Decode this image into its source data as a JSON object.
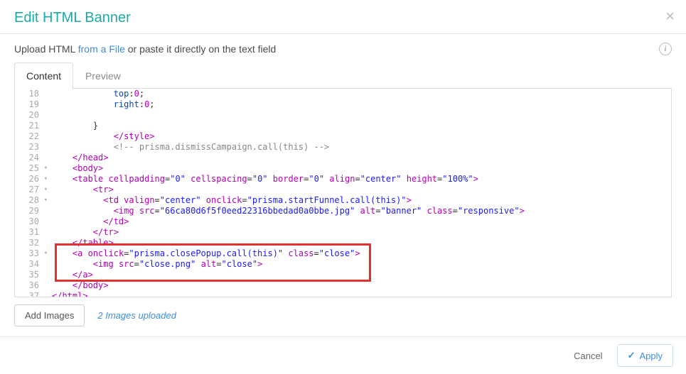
{
  "modal": {
    "title": "Edit HTML Banner",
    "close_glyph": "×"
  },
  "upload": {
    "prefix": "Upload HTML ",
    "link": "from a File",
    "suffix": " or paste it directly on the text field",
    "info_glyph": "i"
  },
  "tabs": {
    "content": "Content",
    "preview": "Preview"
  },
  "code": {
    "lines": [
      {
        "n": 18,
        "indent": "            ",
        "html": "<span class='t-id'>top</span><span class='t-text'>:</span><span class='t-num'>0</span><span class='t-text'>;</span>"
      },
      {
        "n": 19,
        "indent": "            ",
        "html": "<span class='t-id'>right</span><span class='t-text'>:</span><span class='t-num'>0</span><span class='t-text'>;</span>"
      },
      {
        "n": 20,
        "indent": "",
        "html": ""
      },
      {
        "n": 21,
        "indent": "        ",
        "html": "<span class='t-text'>}</span>"
      },
      {
        "n": 22,
        "indent": "            ",
        "html": "<span class='t-tag'>&lt;/style&gt;</span>"
      },
      {
        "n": 23,
        "indent": "            ",
        "html": "<span class='t-com'>&lt;!-- prisma.dismissCampaign.call(this) --&gt;</span>"
      },
      {
        "n": 24,
        "indent": "    ",
        "html": "<span class='t-tag'>&lt;/head&gt;</span>"
      },
      {
        "n": 25,
        "fold": true,
        "indent": "    ",
        "html": "<span class='t-tag'>&lt;body&gt;</span>"
      },
      {
        "n": 26,
        "fold": true,
        "indent": "    ",
        "html": "<span class='t-tag'>&lt;table</span> <span class='t-attr'>cellpadding</span><span class='t-text'>=</span><span class='t-str'>\"0\"</span> <span class='t-attr'>cellspacing</span><span class='t-text'>=</span><span class='t-str'>\"0\"</span> <span class='t-attr'>border</span><span class='t-text'>=</span><span class='t-str'>\"0\"</span> <span class='t-attr'>align</span><span class='t-text'>=</span><span class='t-str'>\"center\"</span> <span class='t-attr'>height</span><span class='t-text'>=</span><span class='t-str'>\"100%\"</span><span class='t-tag'>&gt;</span>"
      },
      {
        "n": 27,
        "fold": true,
        "indent": "        ",
        "html": "<span class='t-tag'>&lt;tr&gt;</span>"
      },
      {
        "n": 28,
        "fold": true,
        "indent": "          ",
        "html": "<span class='t-tag'>&lt;td</span> <span class='t-attr'>valign</span><span class='t-text'>=</span><span class='t-str'>\"center\"</span> <span class='t-attr'>onclick</span><span class='t-text'>=</span><span class='t-str'>\"prisma.startFunnel.call(this)\"</span><span class='t-tag'>&gt;</span>"
      },
      {
        "n": 29,
        "indent": "            ",
        "html": "<span class='t-tag'>&lt;img</span> <span class='t-attr'>src</span><span class='t-text'>=</span><span class='t-str'>\"66ca80d6f5f0eed22316bbedad0a0bbe.jpg\"</span> <span class='t-attr'>alt</span><span class='t-text'>=</span><span class='t-str'>\"banner\"</span> <span class='t-attr'>class</span><span class='t-text'>=</span><span class='t-str'>\"responsive\"</span><span class='t-tag'>&gt;</span>"
      },
      {
        "n": 30,
        "indent": "          ",
        "html": "<span class='t-tag'>&lt;/td&gt;</span>"
      },
      {
        "n": 31,
        "indent": "        ",
        "html": "<span class='t-tag'>&lt;/tr&gt;</span>"
      },
      {
        "n": 32,
        "indent": "    ",
        "html": "<span class='t-tag'>&lt;/table&gt;</span>"
      },
      {
        "n": 33,
        "fold": true,
        "indent": "    ",
        "html": "<span class='t-tag'>&lt;a</span> <span class='t-attr'>onclick</span><span class='t-text'>=</span><span class='t-str'>\"prisma.closePopup.call(this)\"</span> <span class='t-attr'>class</span><span class='t-text'>=</span><span class='t-str'>\"close\"</span><span class='t-tag'>&gt;</span>"
      },
      {
        "n": 34,
        "indent": "        ",
        "html": "<span class='t-tag'>&lt;img</span> <span class='t-attr'>src</span><span class='t-text'>=</span><span class='t-str'>\"close.png\"</span> <span class='t-attr'>alt</span><span class='t-text'>=</span><span class='t-str'>\"close\"</span><span class='t-tag'>&gt;</span>"
      },
      {
        "n": 35,
        "indent": "    ",
        "html": "<span class='t-tag'>&lt;/a&gt;</span>"
      },
      {
        "n": 36,
        "indent": "    ",
        "html": "<span class='t-tag'>&lt;/body&gt;</span>"
      },
      {
        "n": 37,
        "indent": "",
        "html": "<span class='t-tag'>&lt;/html&gt;</span>"
      }
    ]
  },
  "bottom": {
    "add_images": "Add Images",
    "uploaded": "2 Images uploaded"
  },
  "footer": {
    "cancel": "Cancel",
    "apply": "Apply",
    "check": "✓"
  }
}
